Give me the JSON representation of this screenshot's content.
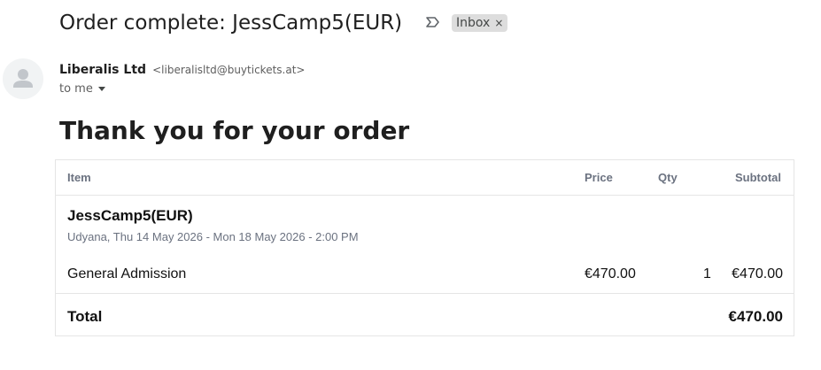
{
  "email": {
    "subject": "Order complete: JessCamp5(EUR)",
    "label": "Inbox",
    "label_remove": "×",
    "sender_name": "Liberalis Ltd",
    "sender_email": "<liberalisltd@buytickets.at>",
    "recipient": "to me"
  },
  "body": {
    "heading": "Thank you for your order",
    "table": {
      "headers": {
        "item": "Item",
        "price": "Price",
        "qty": "Qty",
        "subtotal": "Subtotal"
      },
      "product": {
        "name": "JessCamp5(EUR)",
        "details": "Udyana, Thu 14 May 2026 - Mon 18 May 2026 - 2:00 PM"
      },
      "line_item": {
        "name": "General Admission",
        "price": "€470.00",
        "qty": "1",
        "subtotal": "€470.00"
      },
      "total": {
        "label": "Total",
        "value": "€470.00"
      }
    }
  },
  "icons": {
    "avatar": "person-icon",
    "important": "importance-marker-icon",
    "label_remove": "close-icon",
    "recipient_toggle": "caret-down-icon"
  }
}
